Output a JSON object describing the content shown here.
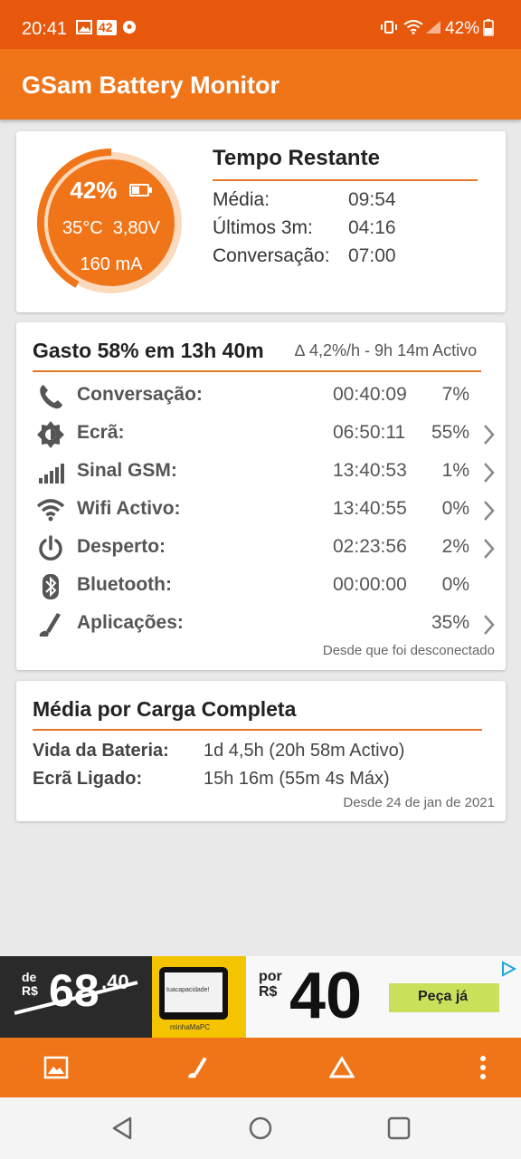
{
  "status_bar": {
    "time": "20:41",
    "notif_badge": "42",
    "battery_percent": "42%"
  },
  "app_bar": {
    "title": "GSam Battery Monitor"
  },
  "summary": {
    "ring_percent": "42%",
    "ring_level": 0.42,
    "ring_temp_voltage": "35°C  3,80V",
    "ring_current": "160 mA",
    "title": "Tempo Restante",
    "rows": [
      {
        "label": "Média:",
        "value": "09:54"
      },
      {
        "label": "Últimos 3m:",
        "value": "04:16"
      },
      {
        "label": "Conversação:",
        "value": "07:00"
      }
    ]
  },
  "usage": {
    "title": "Gasto 58% em 13h 40m",
    "subtitle": "∆ 4,2%/h - 9h 14m Activo",
    "items": [
      {
        "label": "Conversação:",
        "duration": "00:40:09",
        "percent": "7%",
        "icon": "phone-icon",
        "chevron": false
      },
      {
        "label": "Ecrã:",
        "duration": "06:50:11",
        "percent": "55%",
        "icon": "brightness-icon",
        "chevron": true
      },
      {
        "label": "Sinal GSM:",
        "duration": "13:40:53",
        "percent": "1%",
        "icon": "signal-bars-icon",
        "chevron": true
      },
      {
        "label": "Wifi Activo:",
        "duration": "13:40:55",
        "percent": "0%",
        "icon": "wifi-icon",
        "chevron": true
      },
      {
        "label": "Desperto:",
        "duration": "02:23:56",
        "percent": "2%",
        "icon": "power-icon",
        "chevron": true
      },
      {
        "label": "Bluetooth:",
        "duration": "00:00:00",
        "percent": "0%",
        "icon": "bluetooth-icon",
        "chevron": false
      },
      {
        "label": "Aplicações:",
        "duration": "",
        "percent": "35%",
        "icon": "apps-brush-icon",
        "chevron": true
      }
    ],
    "footer": "Desde que foi desconectado"
  },
  "average": {
    "title": "Média por Carga Completa",
    "rows": [
      {
        "label": "Vida da Bateria:",
        "value": "1d 4,5h (20h 58m Activo)"
      },
      {
        "label": "Ecrã Ligado:",
        "value": "15h 16m (55m 4s Máx)"
      }
    ],
    "footer": "Desde 24 de jan de 2021"
  },
  "ad": {
    "old_price_prefix": "de R$",
    "old_price": "68",
    "old_price_cents": ",40",
    "new_price_prefix": "por R$",
    "new_price": "40",
    "device_screen_text": "tuacapacidade!",
    "device_brand": "minhaMaPC",
    "cta": "Peça já"
  },
  "bottom_bar": {
    "icons": [
      "image-icon",
      "apps-brush-icon",
      "delta-icon",
      "more-vert-icon"
    ]
  },
  "nav_bar": {
    "icons": [
      "back-icon",
      "home-icon",
      "recents-icon"
    ]
  },
  "colors": {
    "status_bar": "#e8580c",
    "app_bar": "#f07519",
    "accent": "#f07519",
    "ring_track": "#fbd9bd"
  }
}
